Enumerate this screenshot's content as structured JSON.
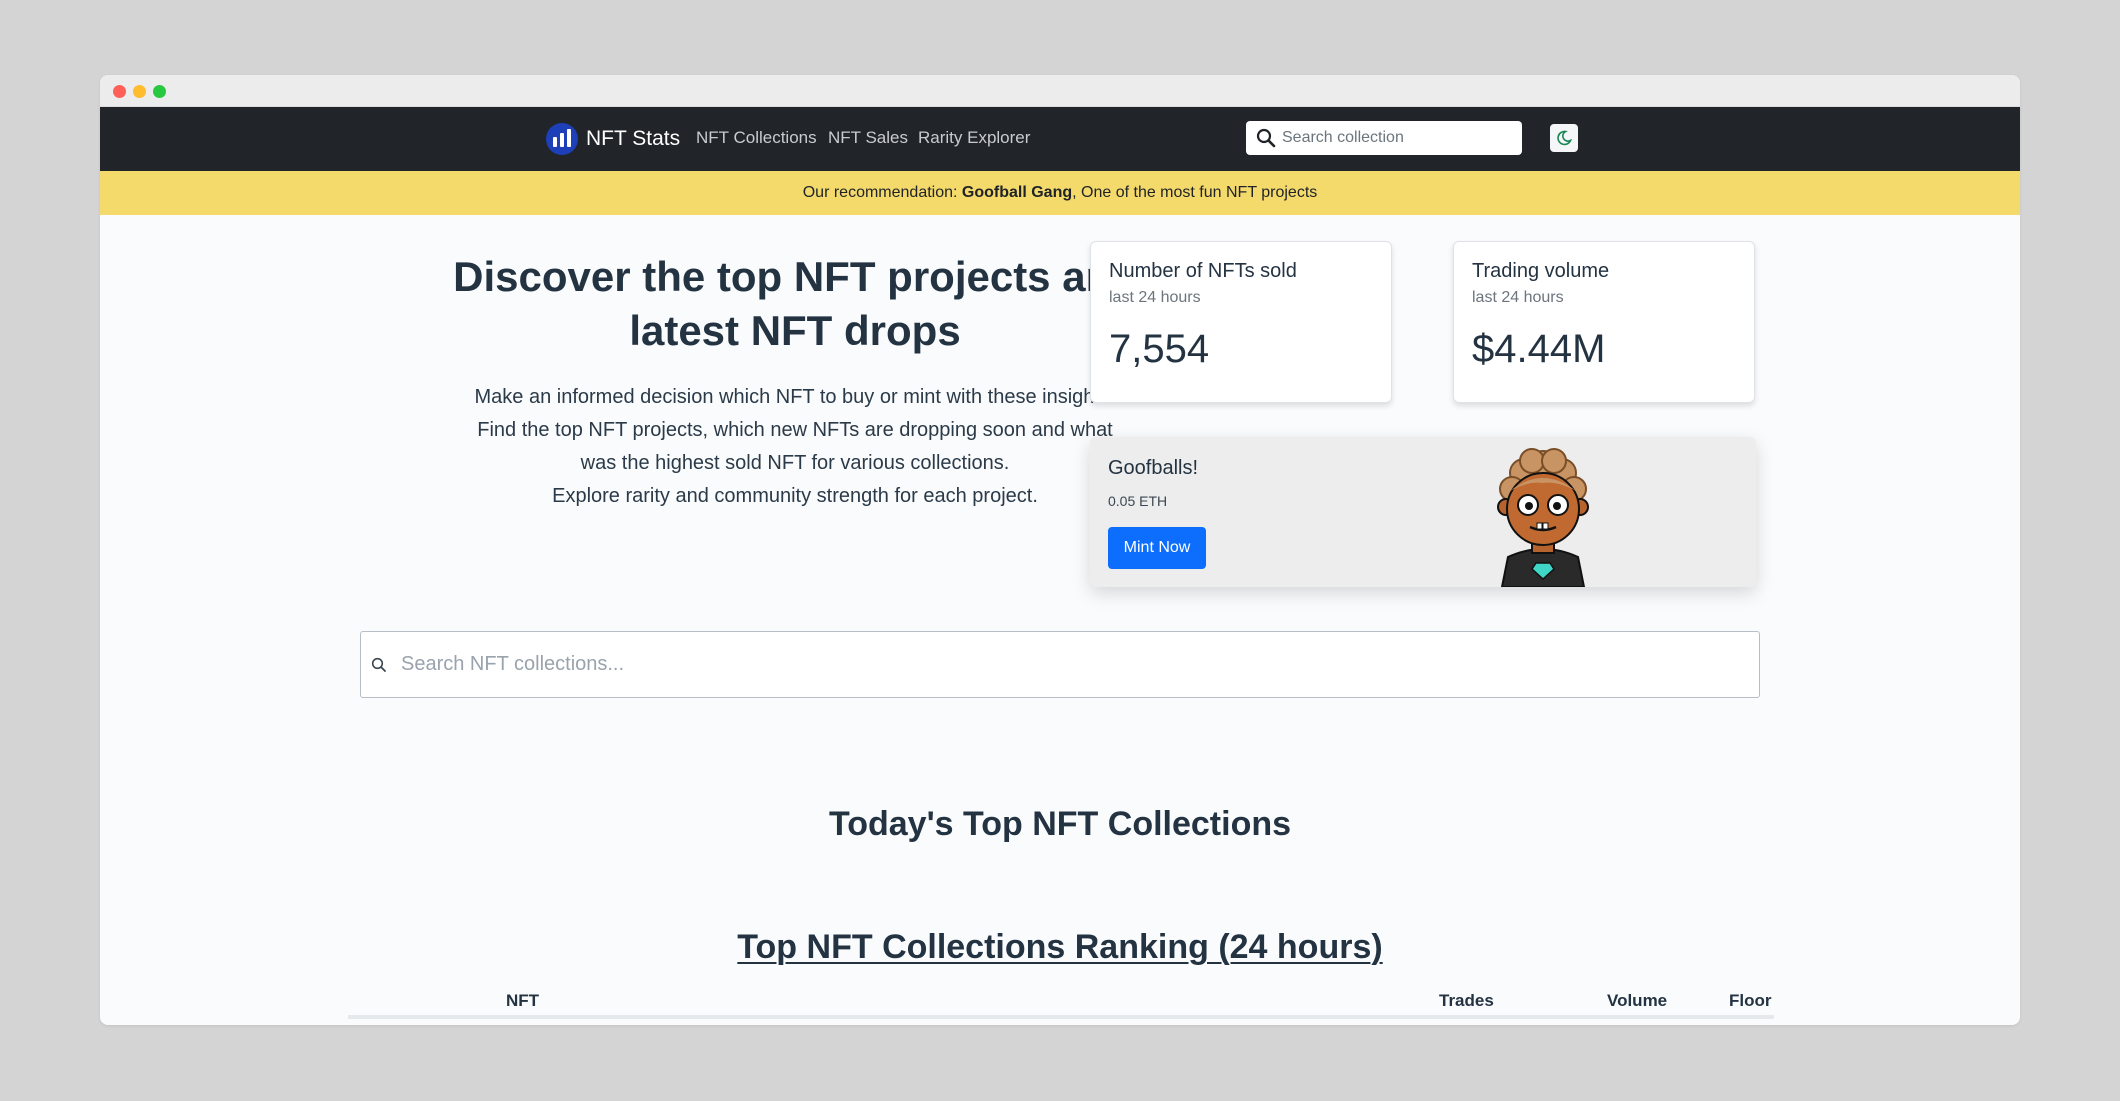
{
  "navbar": {
    "brand": "NFT Stats",
    "links": [
      "NFT Collections",
      "NFT Sales",
      "Rarity Explorer"
    ],
    "search_placeholder": "Search collection"
  },
  "banner": {
    "prefix": "Our recommendation: ",
    "highlight": "Goofball Gang",
    "suffix": ", One of the most fun NFT projects"
  },
  "hero": {
    "title_line1": "Discover the top NFT projects and",
    "title_line2": "latest NFT drops",
    "desc_lines": [
      "Make an informed decision which NFT to buy or mint with these insights.",
      "Find the top NFT projects, which new NFTs are dropping soon and what",
      "was the highest sold NFT for various collections.",
      "Explore rarity and community strength for each project."
    ]
  },
  "stats": [
    {
      "title": "Number of NFTs sold",
      "subtitle": "last 24 hours",
      "value": "7,554"
    },
    {
      "title": "Trading volume",
      "subtitle": "last 24 hours",
      "value": "$4.44M"
    }
  ],
  "mint": {
    "name": "Goofballs!",
    "price": "0.05 ETH",
    "button": "Mint Now"
  },
  "search": {
    "placeholder": "Search NFT collections..."
  },
  "sections": {
    "top_collections": "Today's Top NFT Collections",
    "ranking": "Top NFT Collections Ranking (24 hours)"
  },
  "table": {
    "columns": [
      "NFT",
      "Trades",
      "Volume",
      "Floor"
    ]
  },
  "colors": {
    "navbar_bg": "#212429",
    "banner_bg": "#f4d96b",
    "accent": "#0d6efd",
    "brand_logo": "#1d3fb8"
  }
}
